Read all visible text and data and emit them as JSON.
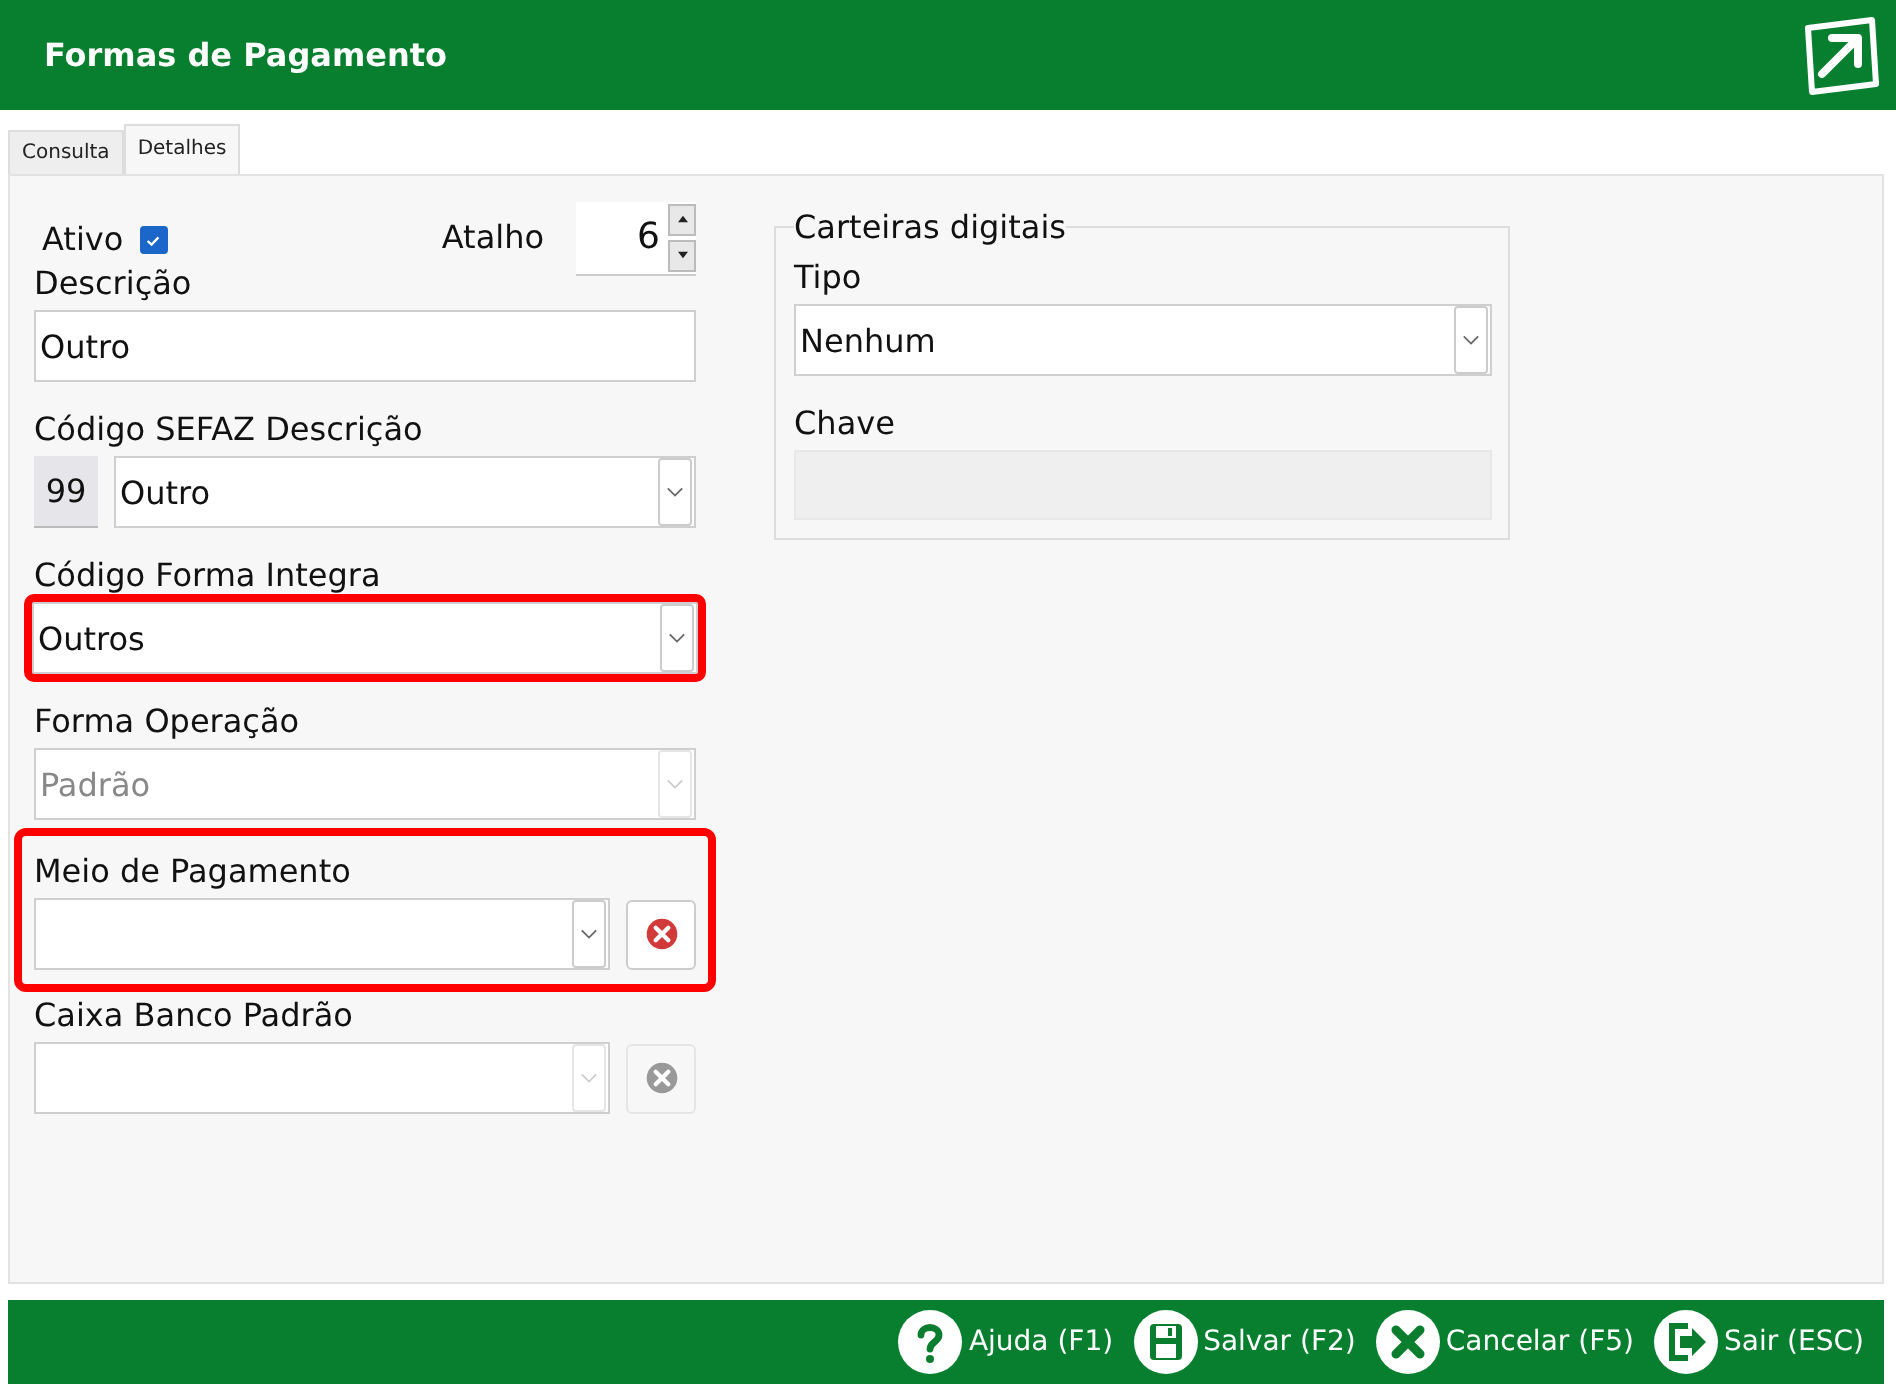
{
  "header": {
    "title": "Formas de Pagamento"
  },
  "tabs": [
    {
      "label": "Consulta",
      "selected": false
    },
    {
      "label": "Detalhes",
      "selected": true
    }
  ],
  "ativo": {
    "label": "Ativo",
    "checked": true
  },
  "atalho": {
    "label": "Atalho",
    "value": "6"
  },
  "fields": [
    {
      "kind": "text",
      "label": "Descrição",
      "value": "Outro"
    },
    {
      "kind": "code-select",
      "label": "Código SEFAZ Descrição",
      "code": "99",
      "value": "Outro"
    },
    {
      "kind": "select",
      "label": "Código Forma Integra",
      "value": "Outros",
      "highlighted": true
    },
    {
      "kind": "select",
      "label": "Forma Operação",
      "value": "Padrão",
      "disabled": true
    },
    {
      "kind": "select-clear",
      "label": "Meio de Pagamento",
      "highlighted": true,
      "disabled": false
    },
    {
      "kind": "select-clear",
      "label": "Caixa Banco Padrão",
      "disabled": true
    }
  ],
  "wallet": {
    "legend": "Carteiras digitais",
    "tipo": {
      "label": "Tipo",
      "value": "Nenhum"
    },
    "chave": {
      "label": "Chave",
      "disabled": true
    }
  },
  "footer_buttons": [
    {
      "kind": "help",
      "label": "Ajuda (F1)"
    },
    {
      "kind": "save",
      "label": "Salvar (F2)"
    },
    {
      "kind": "cancel",
      "label": "Cancelar (F5)"
    },
    {
      "kind": "exit",
      "label": "Sair (ESC)"
    }
  ]
}
